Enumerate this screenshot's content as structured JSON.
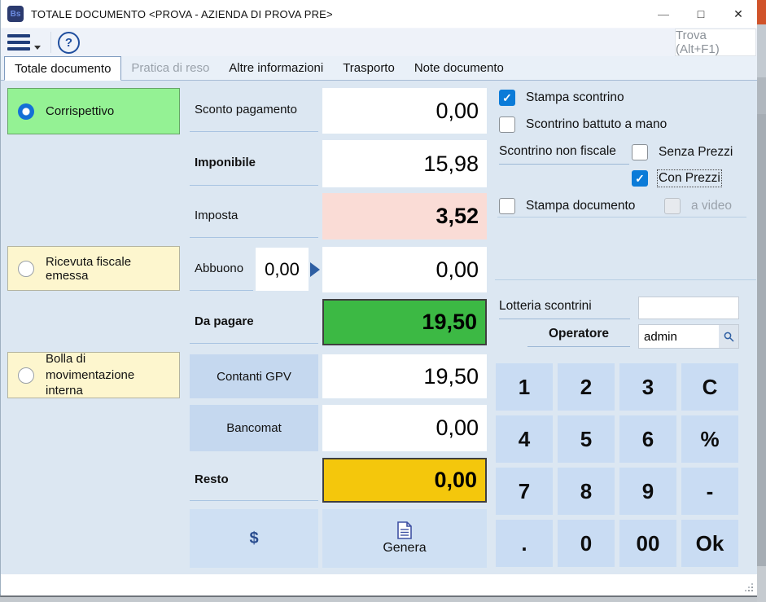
{
  "window": {
    "title": "TOTALE DOCUMENTO <PROVA - AZIENDA DI PROVA PRE>",
    "app_icon": "Bs",
    "controls": {
      "minimize": "—",
      "maximize": "□",
      "close": "✕"
    }
  },
  "toolbar": {
    "trova_label": "Trova (Alt+F1)"
  },
  "icons": {
    "help": "?"
  },
  "tabs": [
    {
      "label": "Totale documento",
      "state": "active"
    },
    {
      "label": "Pratica di reso",
      "state": "disabled"
    },
    {
      "label": "Altre informazioni",
      "state": "normal"
    },
    {
      "label": "Trasporto",
      "state": "normal"
    },
    {
      "label": "Note documento",
      "state": "normal"
    }
  ],
  "document_types": [
    {
      "label": "Corrispettivo",
      "selected": true
    },
    {
      "label": "Ricevuta fiscale emessa",
      "selected": false
    },
    {
      "label": "Bolla di movimentazione interna",
      "selected": false
    }
  ],
  "payment": {
    "sconto": {
      "label": "Sconto pagamento",
      "value": "0,00"
    },
    "imponibile": {
      "label": "Imponibile",
      "value": "15,98"
    },
    "imposta": {
      "label": "Imposta",
      "value": "3,52"
    },
    "abbuono": {
      "label": "Abbuono",
      "pct": "0,00",
      "value": "0,00"
    },
    "da_pagare": {
      "label": "Da pagare",
      "value": "19,50"
    },
    "contanti": {
      "label": "Contanti GPV",
      "value": "19,50"
    },
    "bancomat": {
      "label": "Bancomat",
      "value": "0,00"
    },
    "resto": {
      "label": "Resto",
      "value": "0,00"
    },
    "dollar_label": "$",
    "genera_label": "Genera"
  },
  "print_options": {
    "stampa_scontrino": {
      "label": "Stampa scontrino",
      "checked": true
    },
    "scontrino_mano": {
      "label": "Scontrino battuto a mano",
      "checked": false
    },
    "scontrino_non_fiscale_label": "Scontrino non fiscale",
    "senza_prezzi": {
      "label": "Senza Prezzi",
      "checked": false
    },
    "con_prezzi": {
      "label": "Con Prezzi",
      "checked": true
    },
    "stampa_documento": {
      "label": "Stampa documento",
      "checked": false
    },
    "a_video": {
      "label": "a video",
      "checked": false,
      "enabled": false
    }
  },
  "operator": {
    "lotteria_label": "Lotteria scontrini",
    "lotteria_value": "",
    "operatore_label": "Operatore",
    "operatore_value": "admin"
  },
  "numpad": {
    "keys": [
      "1",
      "2",
      "3",
      "C",
      "4",
      "5",
      "6",
      "%",
      "7",
      "8",
      "9",
      "-",
      ".",
      "0",
      "00",
      "Ok"
    ]
  },
  "colors": {
    "accent_blue": "#0b7bd8",
    "da_pagare_green": "#3cb944",
    "resto_yellow": "#f4c70c",
    "imposta_pink": "#fadcd6",
    "corrispettivo_green": "#94f294",
    "option_yellow": "#fdf6ce",
    "key_blue": "#c9dcf3",
    "panel_blue": "#dce7f2"
  }
}
